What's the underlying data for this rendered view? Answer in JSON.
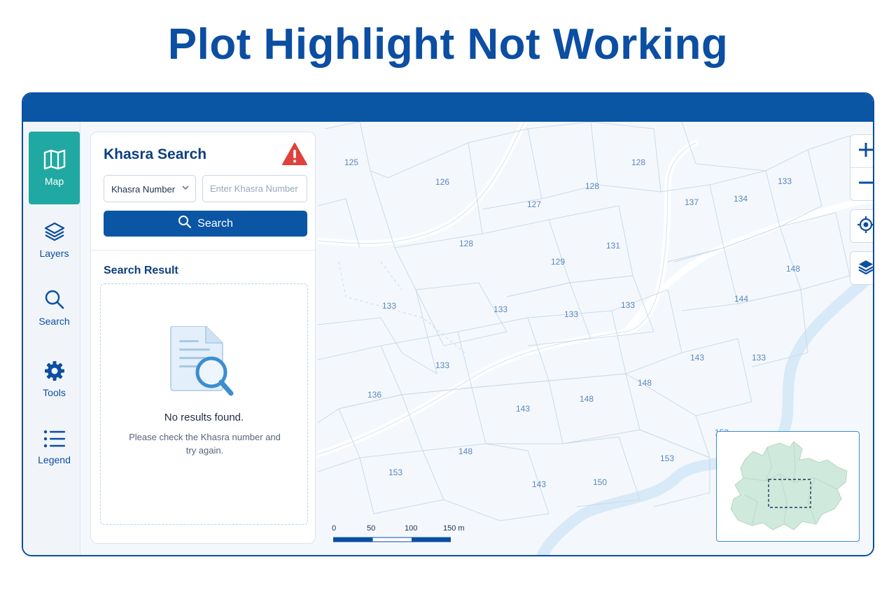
{
  "page": {
    "title": "Plot Highlight Not Working"
  },
  "colors": {
    "brand": "#0b55a5",
    "active_nav": "#20a9a2",
    "warning": "#e0413a",
    "river": "#d8e9f7"
  },
  "sidebar": {
    "items": [
      {
        "label": "Map",
        "icon": "map-icon",
        "active": true
      },
      {
        "label": "Layers",
        "icon": "layers-icon",
        "active": false
      },
      {
        "label": "Search",
        "icon": "search-icon",
        "active": false
      },
      {
        "label": "Tools",
        "icon": "gear-icon",
        "active": false
      },
      {
        "label": "Legend",
        "icon": "list-icon",
        "active": false
      }
    ]
  },
  "search_panel": {
    "title": "Khasra Search",
    "warning_icon": "warning-triangle-icon",
    "search_type": "Khasra Number",
    "input_placeholder": "Enter Khasra Number",
    "input_value": "",
    "search_button": "Search",
    "result_title": "Search Result",
    "empty_title": "No results found.",
    "empty_message": "Please check the Khasra number and try again."
  },
  "map": {
    "plot_labels": [
      "125",
      "126",
      "127",
      "128",
      "128",
      "128",
      "129",
      "131",
      "137",
      "134",
      "133",
      "133",
      "133",
      "133",
      "133",
      "144",
      "148",
      "133",
      "133",
      "136",
      "143",
      "148",
      "148",
      "143",
      "133",
      "143",
      "148",
      "153",
      "153",
      "143",
      "150",
      "153"
    ],
    "controls": [
      "zoom-in-icon",
      "zoom-out-icon",
      "locate-icon",
      "layers-icon"
    ],
    "scale": {
      "ticks": [
        "0",
        "50",
        "100",
        "150 m"
      ]
    }
  }
}
